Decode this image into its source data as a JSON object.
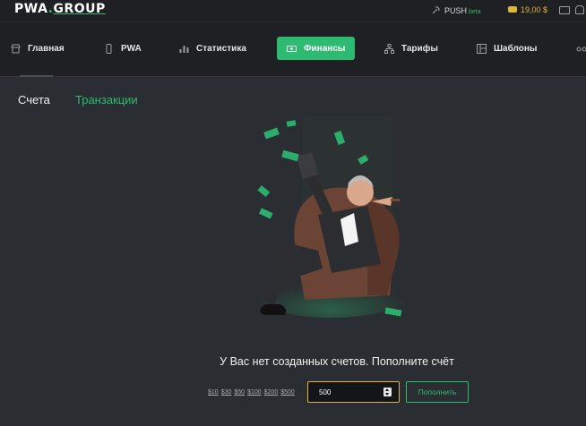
{
  "logo": {
    "text": "PWA.GROUP",
    "part1": "PWA",
    "dot": ".",
    "part2": "GROUP"
  },
  "topbar": {
    "push_label": "PUSH",
    "push_badge": "beta",
    "balance": "19,00 $"
  },
  "nav": {
    "items": [
      {
        "label": "Главная",
        "icon": "store-icon"
      },
      {
        "label": "PWA",
        "icon": "phone-icon"
      },
      {
        "label": "Статистика",
        "icon": "chart-icon"
      },
      {
        "label": "Финансы",
        "icon": "money-icon",
        "active": true
      },
      {
        "label": "Тарифы",
        "icon": "hierarchy-icon"
      },
      {
        "label": "Шаблоны",
        "icon": "template-icon"
      }
    ]
  },
  "tabs": {
    "accounts": "Счета",
    "transactions": "Транзакции"
  },
  "empty_message": "У Вас нет созданных счетов. Пополните счёт",
  "quick_amounts": [
    "$10",
    "$30",
    "$50",
    "$100",
    "$200",
    "$500"
  ],
  "amount_input": {
    "value": "500"
  },
  "topup_button": "Пополнить",
  "colors": {
    "accent": "#2dbb72",
    "background": "#2a2d31",
    "header": "#1e2023",
    "input_border": "#e0b43a"
  }
}
